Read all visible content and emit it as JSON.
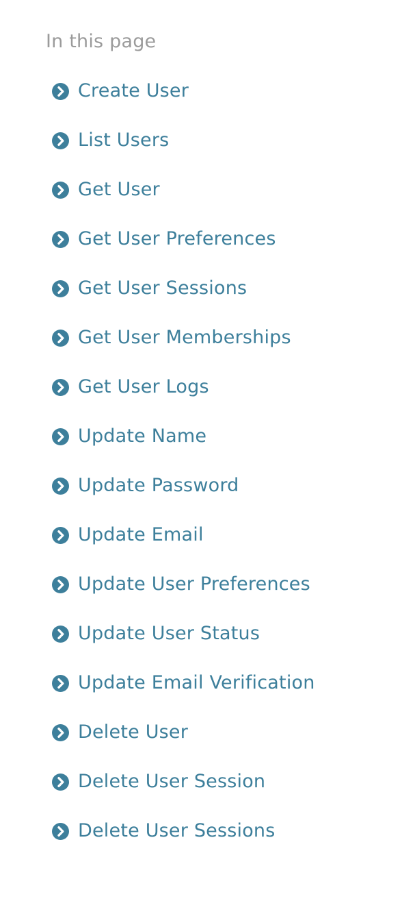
{
  "toc": {
    "heading": "In this page",
    "item_icon": "chevron-circle-right-icon",
    "colors": {
      "heading": "#9b9b9b",
      "link": "#3d7f9b",
      "icon": "#3d7f9b"
    },
    "items": [
      {
        "label": "Create User"
      },
      {
        "label": "List Users"
      },
      {
        "label": "Get User"
      },
      {
        "label": "Get User Preferences"
      },
      {
        "label": "Get User Sessions"
      },
      {
        "label": "Get User Memberships"
      },
      {
        "label": "Get User Logs"
      },
      {
        "label": "Update Name"
      },
      {
        "label": "Update Password"
      },
      {
        "label": "Update Email"
      },
      {
        "label": "Update User Preferences"
      },
      {
        "label": "Update User Status"
      },
      {
        "label": "Update Email Verification"
      },
      {
        "label": "Delete User"
      },
      {
        "label": "Delete User Session"
      },
      {
        "label": "Delete User Sessions"
      }
    ]
  }
}
